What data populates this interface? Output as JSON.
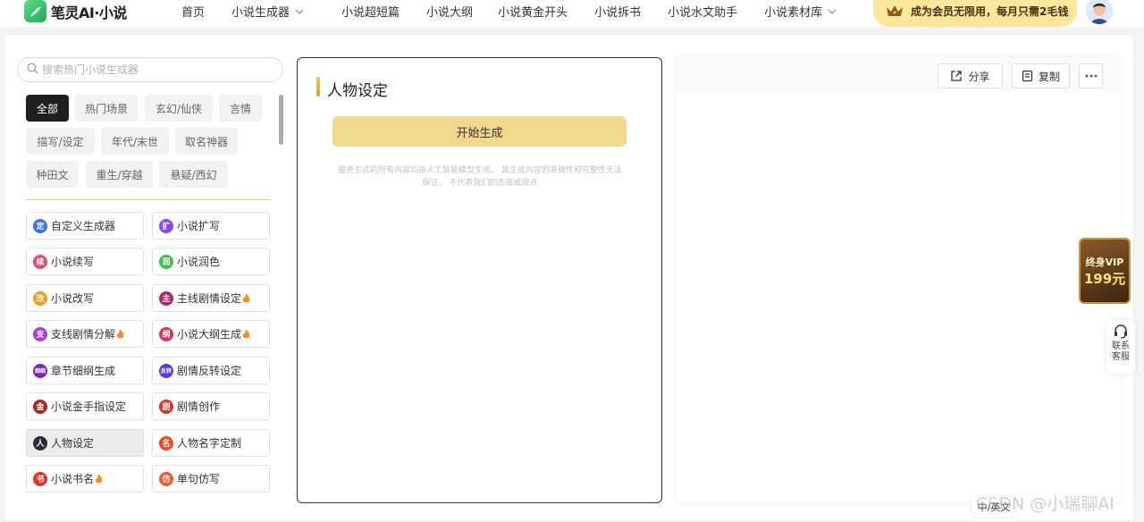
{
  "brand": {
    "name": "笔灵AI·小说"
  },
  "nav": [
    {
      "label": "首页",
      "dropdown": false
    },
    {
      "label": "小说生成器",
      "dropdown": true
    },
    {
      "label": "小说超短篇",
      "dropdown": false
    },
    {
      "label": "小说大纲",
      "dropdown": false
    },
    {
      "label": "小说黄金开头",
      "dropdown": false
    },
    {
      "label": "小说拆书",
      "dropdown": false
    },
    {
      "label": "小说水文助手",
      "dropdown": false
    },
    {
      "label": "小说素材库",
      "dropdown": true
    }
  ],
  "promo": {
    "text": "成为会员无限用，每月只需2毛钱"
  },
  "search": {
    "placeholder": "搜索热门小说生成器",
    "value": ""
  },
  "categories": [
    "全部",
    "热门场景",
    "玄幻/仙侠",
    "言情",
    "描写/设定",
    "年代/末世",
    "取名神器",
    "种田文",
    "重生/穿越",
    "悬疑/西幻"
  ],
  "active_category": "全部",
  "tools": [
    {
      "label": "自定义生成器",
      "icon": "定",
      "color": "#3b6ff5",
      "hot": false
    },
    {
      "label": "小说扩写",
      "icon": "扩",
      "color": "#8b49e8",
      "hot": false
    },
    {
      "label": "小说续写",
      "icon": "续",
      "color": "#e8466a",
      "hot": false
    },
    {
      "label": "小说润色",
      "icon": "润",
      "color": "#3fbf4c",
      "hot": false
    },
    {
      "label": "小说改写",
      "icon": "改",
      "color": "#f59a23",
      "hot": false
    },
    {
      "label": "主线剧情设定",
      "icon": "主",
      "color": "#b3246e",
      "hot": true
    },
    {
      "label": "支线剧情分解",
      "icon": "支",
      "color": "#a93dd4",
      "hot": true
    },
    {
      "label": "小说大纲生成",
      "icon": "纲",
      "color": "#d9334f",
      "hot": true
    },
    {
      "label": "章节细纲生成",
      "icon": "细纲",
      "color": "#7a2ab8",
      "hot": false
    },
    {
      "label": "剧情反转设定",
      "icon": "反转",
      "color": "#5a3bd6",
      "hot": false
    },
    {
      "label": "小说金手指设定",
      "icon": "金",
      "color": "#a3281f",
      "hot": false
    },
    {
      "label": "剧情创作",
      "icon": "剧",
      "color": "#d8342b",
      "hot": false
    },
    {
      "label": "人物设定",
      "icon": "人",
      "color": "#2b2b3a",
      "hot": false,
      "active": true
    },
    {
      "label": "人物名字定制",
      "icon": "名",
      "color": "#f04a24",
      "hot": false
    },
    {
      "label": "小说书名",
      "icon": "书",
      "color": "#e5322b",
      "hot": true
    },
    {
      "label": "单句仿写",
      "icon": "仿",
      "color": "#f05a2a",
      "hot": false
    }
  ],
  "panel": {
    "title": "人物设定",
    "generate_label": "开始生成",
    "disclaimer_line1": "服务生成的所有内容均由人工智能模型生成， 其生成内容的准确性和完整性无法",
    "disclaimer_line2": "保证， 不代表我们的态度或观点"
  },
  "output_toolbar": {
    "share_label": "分享",
    "copy_label": "复制"
  },
  "vip_badge": {
    "line1": "终身VIP",
    "line2": "199元"
  },
  "service": {
    "line1": "联系",
    "line2": "客服"
  },
  "lang_toggle": "中/英文",
  "watermark": "CSDN @小瑞聊AI"
}
